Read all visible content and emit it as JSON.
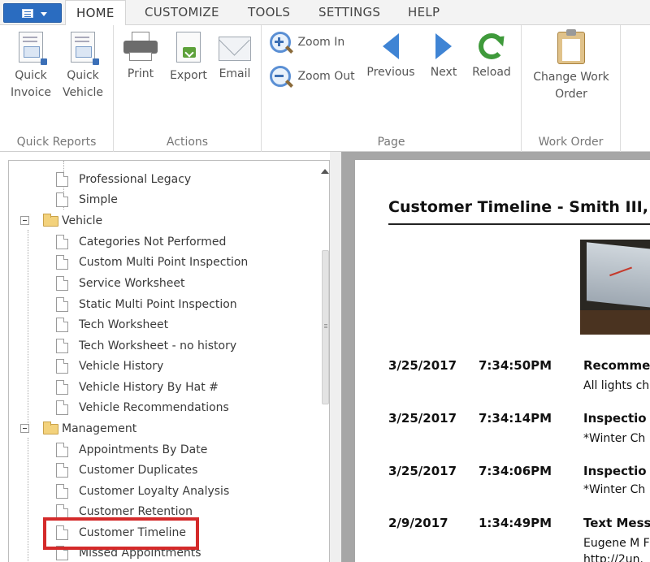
{
  "tabs": [
    "HOME",
    "CUSTOMIZE",
    "TOOLS",
    "SETTINGS",
    "HELP"
  ],
  "ribbon": {
    "groups": [
      {
        "label": "Quick Reports",
        "buttons": [
          "Quick\nInvoice",
          "Quick\nVehicle"
        ]
      },
      {
        "label": "Actions",
        "buttons": [
          "Print",
          "Export",
          "Email"
        ]
      },
      {
        "label": "Page",
        "buttons": [
          "Zoom In",
          "Zoom Out",
          "Previous",
          "Next",
          "Reload"
        ]
      },
      {
        "label": "Work Order",
        "buttons": [
          "Change Work\nOrder"
        ]
      }
    ],
    "quick_invoice": [
      "Quick",
      "Invoice"
    ],
    "quick_vehicle": [
      "Quick",
      "Vehicle"
    ],
    "print": "Print",
    "export": "Export",
    "email": "Email",
    "zoom_in": "Zoom In",
    "zoom_out": "Zoom Out",
    "previous": "Previous",
    "next": "Next",
    "reload": "Reload",
    "change_work_order": [
      "Change Work",
      "Order"
    ],
    "group_quick_reports": "Quick Reports",
    "group_actions": "Actions",
    "group_page": "Page",
    "group_work_order": "Work Order"
  },
  "tree": {
    "items": [
      {
        "type": "report",
        "label": "Professional Legacy"
      },
      {
        "type": "report",
        "label": "Simple"
      },
      {
        "type": "folder",
        "label": "Vehicle"
      },
      {
        "type": "report",
        "label": "Categories Not Performed"
      },
      {
        "type": "report",
        "label": "Custom Multi Point Inspection"
      },
      {
        "type": "report",
        "label": "Service Worksheet"
      },
      {
        "type": "report",
        "label": "Static Multi Point Inspection"
      },
      {
        "type": "report",
        "label": "Tech Worksheet"
      },
      {
        "type": "report",
        "label": "Tech Worksheet - no history"
      },
      {
        "type": "report",
        "label": "Vehicle History"
      },
      {
        "type": "report",
        "label": "Vehicle History By Hat #"
      },
      {
        "type": "report",
        "label": "Vehicle Recommendations"
      },
      {
        "type": "folder",
        "label": "Management"
      },
      {
        "type": "report",
        "label": "Appointments By Date"
      },
      {
        "type": "report",
        "label": "Customer Duplicates"
      },
      {
        "type": "report",
        "label": "Customer Loyalty Analysis"
      },
      {
        "type": "report",
        "label": "Customer Retention"
      },
      {
        "type": "report",
        "label": "Customer Timeline",
        "selected": true
      },
      {
        "type": "report",
        "label": "Missed Appointments"
      }
    ]
  },
  "preview": {
    "title": "Customer Timeline - Smith III,",
    "entries": [
      {
        "date": "3/25/2017",
        "time": "7:34:50PM",
        "heading": "Recomme",
        "text": "All lights ch"
      },
      {
        "date": "3/25/2017",
        "time": "7:34:14PM",
        "heading": "Inspectio",
        "text": "*Winter Ch"
      },
      {
        "date": "3/25/2017",
        "time": "7:34:06PM",
        "heading": "Inspectio",
        "text": "*Winter Ch"
      },
      {
        "date": "2/9/2017",
        "time": "1:34:49PM",
        "heading": "Text Mess",
        "text": "Eugene M F",
        "text2": "http://2un."
      }
    ]
  },
  "colors": {
    "accent": "#2a6cc0",
    "selection_highlight": "#d42a2a"
  }
}
